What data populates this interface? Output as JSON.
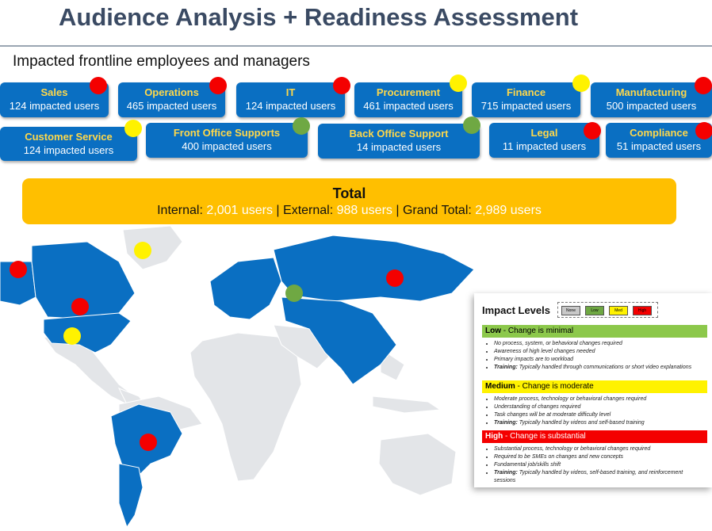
{
  "title": "Audience Analysis + Readiness Assessment",
  "subtitle": "Impacted frontline employees and managers",
  "colors": {
    "card": "#0a6fc2",
    "card_name": "#ffd84a",
    "low": "#6fa843",
    "medium": "#fff200",
    "high": "#f40000",
    "total_bg": "#ffbf00",
    "map_impacted": "#0a6fc2",
    "map_other": "#e3e5e8"
  },
  "groups": [
    {
      "name": "Sales",
      "count": "124 impacted users",
      "level": "high"
    },
    {
      "name": "Operations",
      "count": "465 impacted users",
      "level": "high"
    },
    {
      "name": "IT",
      "count": "124 impacted users",
      "level": "high"
    },
    {
      "name": "Procurement",
      "count": "461 impacted users",
      "level": "medium"
    },
    {
      "name": "Finance",
      "count": "715 impacted users",
      "level": "medium"
    },
    {
      "name": "Manufacturing",
      "count": "500 impacted users",
      "level": "high"
    },
    {
      "name": "Customer Service",
      "count": "124 impacted users",
      "level": "medium"
    },
    {
      "name": "Front Office Supports",
      "count": "400 impacted users",
      "level": "low"
    },
    {
      "name": "Back Office Support",
      "count": "14 impacted users",
      "level": "low"
    },
    {
      "name": "Legal",
      "count": "11 impacted users",
      "level": "high"
    },
    {
      "name": "Compliance",
      "count": "51 impacted users",
      "level": "high"
    }
  ],
  "total": {
    "label": "Total",
    "internal_label": "Internal:",
    "internal_value": "2,001 users",
    "sep1": "|",
    "external_label": "External:",
    "external_value": "988 users",
    "sep2": "|",
    "grand_label": "Grand Total:",
    "grand_value": "2,989 users"
  },
  "map": {
    "regions": [
      {
        "name": "Alaska",
        "level": "high"
      },
      {
        "name": "Greenland",
        "level": "medium"
      },
      {
        "name": "Canada",
        "level": "high"
      },
      {
        "name": "United States",
        "level": "medium"
      },
      {
        "name": "Russia",
        "level": "high"
      },
      {
        "name": "Europe / Central Asia",
        "level": "low"
      },
      {
        "name": "Brazil",
        "level": "high"
      }
    ]
  },
  "legend": {
    "heading": "Impact Levels",
    "keys": [
      "None",
      "Low",
      "Med",
      "High"
    ],
    "key_colors": [
      "#c8c8c8",
      "#6fa843",
      "#fff200",
      "#f40000"
    ],
    "levels": [
      {
        "name": "Low",
        "desc": " - Change is minimal",
        "bullets": [
          "No process, system, or behavioral changes required",
          "Awareness of high level changes needed",
          "Primary impacts are to workload"
        ],
        "training_label": "Training:",
        "training_text": " Typically handled through communications or short video explanations"
      },
      {
        "name": "Medium",
        "desc": " - Change is moderate",
        "bullets": [
          "Moderate process, technology or behavioral changes required",
          "Understanding of changes required",
          "Task changes will be at moderate difficulty level"
        ],
        "training_label": "Training:",
        "training_text": " Typically handled by videos and self-based training"
      },
      {
        "name": "High",
        "desc": " - Change is substantial",
        "bullets": [
          "Substantial process, technology or behavioral changes required",
          "Required to be SMEs on changes and new concepts",
          "Fundamental job/skills shift"
        ],
        "training_label": "Training:",
        "training_text": " Typically handled by videos, self-based training, and reinforcement sessions"
      }
    ]
  }
}
